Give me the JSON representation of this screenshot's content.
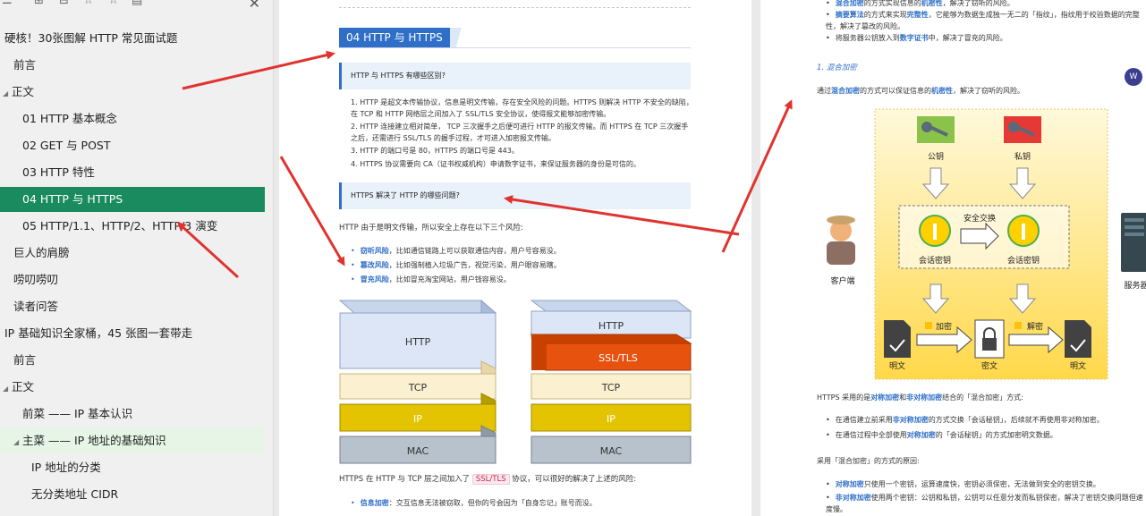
{
  "sidebar": {
    "items": [
      {
        "label": "硬核！30张图解 HTTP 常见面试题",
        "indent": 0,
        "state": ""
      },
      {
        "label": "前言",
        "indent": 1,
        "state": ""
      },
      {
        "label": "正文",
        "indent": 0,
        "state": "expanded"
      },
      {
        "label": "01 HTTP 基本概念",
        "indent": 2,
        "state": ""
      },
      {
        "label": "02 GET 与 POST",
        "indent": 2,
        "state": ""
      },
      {
        "label": "03 HTTP 特性",
        "indent": 2,
        "state": ""
      },
      {
        "label": "04 HTTP 与 HTTPS",
        "indent": 2,
        "state": "active"
      },
      {
        "label": "05 HTTP/1.1、HTTP/2、HTTP/3 演变",
        "indent": 2,
        "state": ""
      },
      {
        "label": "巨人的肩膀",
        "indent": 1,
        "state": ""
      },
      {
        "label": "唠叨唠叨",
        "indent": 1,
        "state": ""
      },
      {
        "label": "读者问答",
        "indent": 1,
        "state": ""
      },
      {
        "label": "IP 基础知识全家桶，45 张图一套带走",
        "indent": 0,
        "state": ""
      },
      {
        "label": "前言",
        "indent": 1,
        "state": ""
      },
      {
        "label": "正文",
        "indent": 0,
        "state": "expanded"
      },
      {
        "label": "前菜 —— IP 基本认识",
        "indent": 2,
        "state": ""
      },
      {
        "label": "主菜 —— IP 地址的基础知识",
        "indent": 2,
        "state": "expanded-hl"
      },
      {
        "label": "IP 地址的分类",
        "indent": 3,
        "state": ""
      },
      {
        "label": "无分类地址 CIDR",
        "indent": 3,
        "state": ""
      }
    ]
  },
  "page1": {
    "section_title": "04 HTTP 与 HTTPS",
    "q1": "HTTP 与 HTTPS 有哪些区别?",
    "q1_list": [
      "HTTP 是超文本传输协议，信息是明文传输，存在安全风险的问题。HTTPS 则解决 HTTP 不安全的缺陷，在 TCP 和 HTTP 网络层之间加入了 SSL/TLS 安全协议，使得报文能够加密传输。",
      "HTTP 连接建立相对简单， TCP 三次握手之后便可进行 HTTP 的报文传输。而 HTTPS 在 TCP 三次握手之后，还需进行 SSL/TLS 的握手过程，才可进入加密报文传输。",
      "HTTP 的端口号是 80，HTTPS 的端口号是 443。",
      "HTTPS 协议需要向 CA（证书权威机构）申请数字证书，来保证服务器的身份是可信的。"
    ],
    "q2": "HTTPS 解决了 HTTP 的哪些问题?",
    "intro": "HTTP 由于是明文传输，所以安全上存在以下三个风险:",
    "risks": [
      {
        "k": "窃听风险",
        "v": "，比如通信链路上可以获取通信内容，用户号容易没。"
      },
      {
        "k": "篡改风险",
        "v": "，比如强制植入垃圾广告，视觉污染，用户眼容易瞎。"
      },
      {
        "k": "冒充风险",
        "v": "，比如冒充淘宝网站，用户钱容易没。"
      }
    ],
    "stack_left": [
      "HTTP",
      "TCP",
      "IP",
      "MAC"
    ],
    "stack_right": [
      "HTTP",
      "SSL/TLS",
      "TCP",
      "IP",
      "MAC"
    ],
    "after_text_a": "HTTPS 在 HTTP 与 TCP 层之间加入了",
    "after_tag": "SSL/TLS",
    "after_text_b": "协议，可以很好的解决了上述的风险:",
    "solve_k": "信息加密",
    "solve_v": "：交互信息无法被窃取，但你的号会因为「自身忘记」账号而没。"
  },
  "page2": {
    "top_items": [
      {
        "k": "混合加密",
        "v": "的方式实现信息的",
        "k2": "机密性",
        "v2": "，解决了窃听的风险。"
      },
      {
        "k": "摘要算法",
        "v": "的方式来实现",
        "k2": "完整性",
        "v2": "，它能够为数据生成独一无二的「指纹」，指纹用于校验数据的完整性，解决了篡改的风险。"
      },
      {
        "k": "",
        "v": "将服务器公钥放入到",
        "k2": "数字证书",
        "v2": "中，解决了冒充的风险。"
      }
    ],
    "sub_title": "1. 混合加密",
    "sub_text_a": "通过",
    "sub_text_k1": "混合加密",
    "sub_text_b": "的方式可以保证信息的",
    "sub_text_k2": "机密性",
    "sub_text_c": "，解决了窃听的风险。",
    "diagram": {
      "public_key": "公钥",
      "private_key": "私钥",
      "secure_exchange": "安全交换",
      "session_key_l": "会话密钥",
      "session_key_r": "会话密钥",
      "client": "客户端",
      "server": "服务器",
      "encrypt": "加密",
      "decrypt": "解密",
      "plain_l": "明文",
      "cipher": "密文",
      "plain_r": "明文"
    },
    "para1_a": "HTTPS 采用的是",
    "para1_k1": "对称加密",
    "para1_b": "和",
    "para1_k2": "非对称加密",
    "para1_c": "结合的「混合加密」方式:",
    "list2": [
      {
        "a": "在通信建立前采用",
        "k": "非对称加密",
        "b": "的方式交换「会话秘钥」，后续就不再使用非对称加密。"
      },
      {
        "a": "在通信过程中全部使用",
        "k": "对称加密",
        "b": "的「会话秘钥」的方式加密明文数据。"
      }
    ],
    "para2": "采用「混合加密」的方式的原因:",
    "list3": [
      {
        "k": "对称加密",
        "b": "只使用一个密钥，运算速度快，密钥必须保密，无法做到安全的密钥交换。"
      },
      {
        "k": "非对称加密",
        "b": "使用两个密钥：公钥和私钥，公钥可以任意分发而私钥保密，解决了密钥交换问题但速度慢。"
      }
    ],
    "badge": "W"
  },
  "colors": {
    "active_bg": "#1a8a5f",
    "accent_blue": "#2f6fc8",
    "arrow_red": "#e0332f"
  }
}
